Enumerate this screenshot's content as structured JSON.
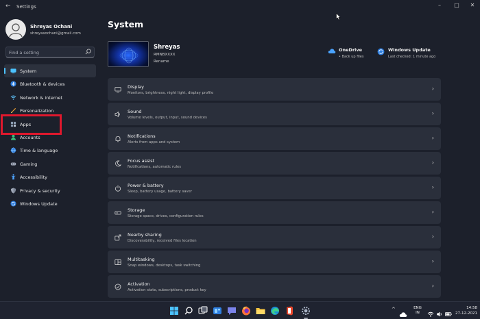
{
  "window": {
    "title": "Settings",
    "back_glyph": "←",
    "controls": {
      "minimize": "–",
      "maximize": "□",
      "close": "✕"
    }
  },
  "user": {
    "name": "Shreyas Ochani",
    "email": "shreyasochani@gmail.com"
  },
  "search": {
    "placeholder": "Find a setting",
    "value": "",
    "icon": "search-icon"
  },
  "sidebar": {
    "items": [
      {
        "label": "System",
        "icon": "monitor-icon",
        "color": "#4cc2ff",
        "active": true
      },
      {
        "label": "Bluetooth & devices",
        "icon": "bluetooth-icon",
        "color": "#4aa3ff"
      },
      {
        "label": "Network & internet",
        "icon": "wifi-icon",
        "color": "#60c6ff"
      },
      {
        "label": "Personalization",
        "icon": "brush-icon",
        "color": "#f0a030"
      },
      {
        "label": "Apps",
        "icon": "apps-icon",
        "color": "#8a9bb0"
      },
      {
        "label": "Accounts",
        "icon": "person-icon",
        "color": "#3ec07b"
      },
      {
        "label": "Time & language",
        "icon": "globe-icon",
        "color": "#4aa3ff"
      },
      {
        "label": "Gaming",
        "icon": "gamepad-icon",
        "color": "#a0a8b8"
      },
      {
        "label": "Accessibility",
        "icon": "accessibility-icon",
        "color": "#4ea4ff"
      },
      {
        "label": "Privacy & security",
        "icon": "shield-icon",
        "color": "#a0a8b8"
      },
      {
        "label": "Windows Update",
        "icon": "update-icon",
        "color": "#4cc2ff"
      }
    ]
  },
  "main": {
    "title": "System",
    "device": {
      "name": "Shreyas",
      "model": "RMNBXXXX",
      "rename": "Rename"
    },
    "quick": [
      {
        "title": "OneDrive",
        "sub": "• Back up files",
        "icon": "cloud-icon",
        "color": "#4aa3ff"
      },
      {
        "title": "Windows Update",
        "sub": "Last checked: 1 minute ago",
        "icon": "update-icon",
        "color": "#4aa3ff"
      }
    ],
    "cards": [
      {
        "title": "Display",
        "sub": "Monitors, brightness, night light, display profile",
        "icon": "display-icon"
      },
      {
        "title": "Sound",
        "sub": "Volume levels, output, input, sound devices",
        "icon": "speaker-icon"
      },
      {
        "title": "Notifications",
        "sub": "Alerts from apps and system",
        "icon": "bell-icon"
      },
      {
        "title": "Focus assist",
        "sub": "Notifications, automatic rules",
        "icon": "moon-icon"
      },
      {
        "title": "Power & battery",
        "sub": "Sleep, battery usage, battery saver",
        "icon": "power-icon"
      },
      {
        "title": "Storage",
        "sub": "Storage space, drives, configuration rules",
        "icon": "storage-icon"
      },
      {
        "title": "Nearby sharing",
        "sub": "Discoverability, received files location",
        "icon": "share-icon"
      },
      {
        "title": "Multitasking",
        "sub": "Snap windows, desktops, task switching",
        "icon": "multitask-icon"
      },
      {
        "title": "Activation",
        "sub": "Activation state, subscriptions, product key",
        "icon": "check-circle-icon"
      }
    ],
    "chevron": "›"
  },
  "taskbar": {
    "apps": [
      {
        "name": "start-button",
        "icon": "windows-logo-icon",
        "color": "#4cc2ff"
      },
      {
        "name": "search-button",
        "icon": "search-icon",
        "color": "#ffffff"
      },
      {
        "name": "task-view-button",
        "icon": "task-view-icon",
        "color": "#ffffff"
      },
      {
        "name": "widgets-button",
        "icon": "widgets-icon",
        "color": "#4aa3ff"
      },
      {
        "name": "chat-button",
        "icon": "chat-icon",
        "color": "#7b83eb"
      },
      {
        "name": "firefox-button",
        "icon": "firefox-icon",
        "color": "#ff7139"
      },
      {
        "name": "file-explorer-button",
        "icon": "folder-icon",
        "color": "#f5c542"
      },
      {
        "name": "edge-button",
        "icon": "edge-icon",
        "color": "#2fb6a8"
      },
      {
        "name": "office-button",
        "icon": "office-icon",
        "color": "#e8472c"
      },
      {
        "name": "settings-button",
        "icon": "gear-icon",
        "color": "#a9b4c6"
      }
    ],
    "tray_chevron": "^",
    "lang": {
      "line1": "ENG",
      "line2": "IN"
    },
    "time": "14:58",
    "date": "27-12-2021"
  }
}
